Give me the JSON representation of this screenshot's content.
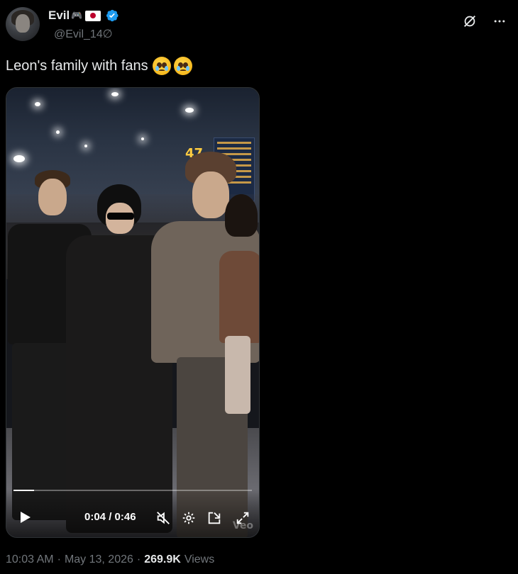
{
  "author": {
    "display_name": "Evil",
    "handle": "@Evil_14∅",
    "badges": [
      "gamepad-icon",
      "japan-flag-icon",
      "verified-badge-icon"
    ],
    "verified_color": "#1d9bf0"
  },
  "actions": {
    "grok_icon": "grok-icon",
    "more_icon": "more-icon"
  },
  "tweet": {
    "text": "Leon's family with fans",
    "emojis": [
      "pleading-face-icon",
      "pleading-face-icon"
    ]
  },
  "video": {
    "time_current": "0:04",
    "time_separator": "/",
    "time_total": "0:46",
    "time_display": "0:04 / 0:46",
    "progress": 0.087,
    "watermark": "Veo",
    "gate_number": "47",
    "controls": [
      "play-icon",
      "mute-icon",
      "settings-icon",
      "pip-icon",
      "fullscreen-icon"
    ]
  },
  "meta": {
    "time": "10:03 AM",
    "date": "May 13, 2026",
    "separator": "·",
    "views_count": "269.9K",
    "views_label": "Views"
  }
}
